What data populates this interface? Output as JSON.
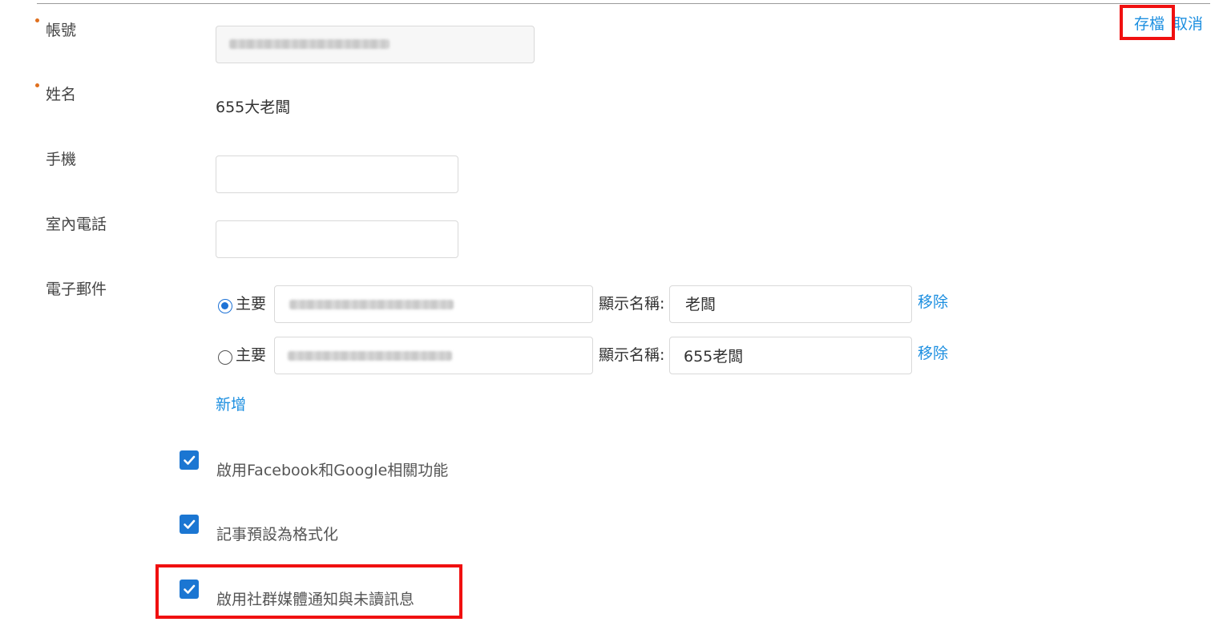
{
  "header": {
    "save_label": "存檔",
    "cancel_label": "取消"
  },
  "form": {
    "account": {
      "label": "帳號",
      "required": true
    },
    "name": {
      "label": "姓名",
      "required": true,
      "value": "655大老闆"
    },
    "mobile": {
      "label": "手機",
      "value": ""
    },
    "landline": {
      "label": "室內電話",
      "value": ""
    },
    "email": {
      "label": "電子郵件",
      "entries": [
        {
          "primary_label": "主要",
          "selected": true,
          "display_name_label": "顯示名稱:",
          "display_name": "老闆",
          "remove_label": "移除"
        },
        {
          "primary_label": "主要",
          "selected": false,
          "display_name_label": "顯示名稱:",
          "display_name": "655老闆",
          "remove_label": "移除"
        }
      ],
      "add_label": "新增"
    }
  },
  "options": [
    {
      "label": "啟用Facebook和Google相關功能",
      "checked": true
    },
    {
      "label": "記事預設為格式化",
      "checked": true
    },
    {
      "label": "啟用社群媒體通知與未讀訊息",
      "checked": true
    }
  ],
  "colors": {
    "link": "#1d8fe0",
    "checkbox": "#1b76d2",
    "required_dot": "#e0701e",
    "highlight": "#f01010"
  }
}
